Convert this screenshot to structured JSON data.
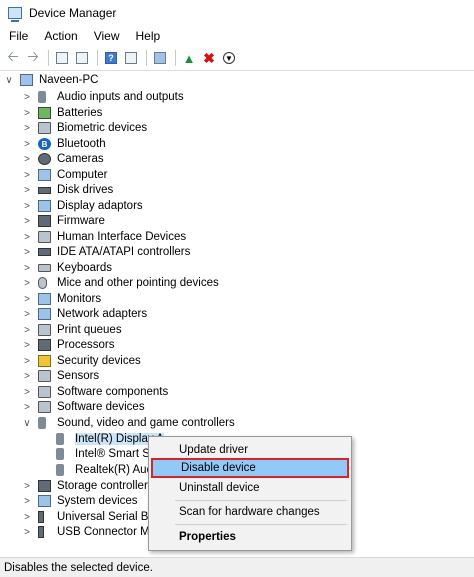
{
  "window": {
    "title": "Device Manager"
  },
  "menu": [
    "File",
    "Action",
    "View",
    "Help"
  ],
  "toolbar": {
    "buttons": [
      "back-icon",
      "forward-icon",
      "properties-view-icon",
      "console-tree-icon",
      "help-icon",
      "show-hidden-icon",
      "scan-monitor-icon",
      "update-driver-icon",
      "uninstall-icon",
      "disable-icon"
    ]
  },
  "tree": {
    "root": "Naveen-PC",
    "categories": [
      "Audio inputs and outputs",
      "Batteries",
      "Biometric devices",
      "Bluetooth",
      "Cameras",
      "Computer",
      "Disk drives",
      "Display adaptors",
      "Firmware",
      "Human Interface Devices",
      "IDE ATA/ATAPI controllers",
      "Keyboards",
      "Mice and other pointing devices",
      "Monitors",
      "Network adapters",
      "Print queues",
      "Processors",
      "Security devices",
      "Sensors",
      "Software components",
      "Software devices",
      "Sound, video and game controllers"
    ],
    "sound_children": [
      "Intel(R) Display A",
      "Intel® Smart Sou",
      "Realtek(R) Audio"
    ],
    "after": [
      "Storage controllers",
      "System devices",
      "Universal Serial Bus",
      "USB Connector Man"
    ]
  },
  "context_menu": {
    "items": [
      "Update driver",
      "Disable device",
      "Uninstall device",
      "Scan for hardware changes",
      "Properties"
    ],
    "highlighted": "Disable device",
    "highlight_color": "#91c9f7",
    "outline_color": "#d9242c"
  },
  "status": {
    "text": "Disables the selected device."
  }
}
